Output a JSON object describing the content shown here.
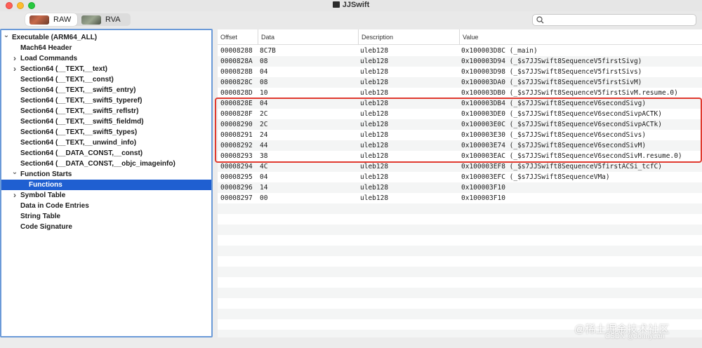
{
  "window": {
    "title": "JJSwift"
  },
  "toolbar": {
    "view_modes": [
      {
        "label": "RAW",
        "active": true
      },
      {
        "label": "RVA",
        "active": false
      }
    ],
    "search": {
      "placeholder": "",
      "value": ""
    }
  },
  "sidebar": {
    "items": [
      {
        "label": "Executable  (ARM64_ALL)",
        "depth": 0,
        "disclosure": "expanded"
      },
      {
        "label": "Mach64 Header",
        "depth": 1,
        "disclosure": "none"
      },
      {
        "label": "Load Commands",
        "depth": 1,
        "disclosure": "collapsed"
      },
      {
        "label": "Section64 (__TEXT,__text)",
        "depth": 1,
        "disclosure": "collapsed"
      },
      {
        "label": "Section64 (__TEXT,__const)",
        "depth": 1,
        "disclosure": "none"
      },
      {
        "label": "Section64 (__TEXT,__swift5_entry)",
        "depth": 1,
        "disclosure": "none"
      },
      {
        "label": "Section64 (__TEXT,__swift5_typeref)",
        "depth": 1,
        "disclosure": "none"
      },
      {
        "label": "Section64 (__TEXT,__swift5_reflstr)",
        "depth": 1,
        "disclosure": "none"
      },
      {
        "label": "Section64 (__TEXT,__swift5_fieldmd)",
        "depth": 1,
        "disclosure": "none"
      },
      {
        "label": "Section64 (__TEXT,__swift5_types)",
        "depth": 1,
        "disclosure": "none"
      },
      {
        "label": "Section64 (__TEXT,__unwind_info)",
        "depth": 1,
        "disclosure": "none"
      },
      {
        "label": "Section64 (__DATA_CONST,__const)",
        "depth": 1,
        "disclosure": "none"
      },
      {
        "label": "Section64 (__DATA_CONST,__objc_imageinfo)",
        "depth": 1,
        "disclosure": "none"
      },
      {
        "label": "Function Starts",
        "depth": 1,
        "disclosure": "expanded"
      },
      {
        "label": "Functions",
        "depth": 2,
        "disclosure": "none",
        "selected": true
      },
      {
        "label": "Symbol Table",
        "depth": 1,
        "disclosure": "collapsed"
      },
      {
        "label": "Data in Code Entries",
        "depth": 1,
        "disclosure": "none"
      },
      {
        "label": "String Table",
        "depth": 1,
        "disclosure": "none"
      },
      {
        "label": "Code Signature",
        "depth": 1,
        "disclosure": "none"
      }
    ]
  },
  "table": {
    "columns": [
      "Offset",
      "Data",
      "Description",
      "Value"
    ],
    "rows": [
      [
        "00008288",
        "8C7B",
        "uleb128",
        "0x100003D8C (_main)"
      ],
      [
        "0000828A",
        "08",
        "uleb128",
        "0x100003D94 (_$s7JJSwift8SequenceV5firstSivg)"
      ],
      [
        "0000828B",
        "04",
        "uleb128",
        "0x100003D98 (_$s7JJSwift8SequenceV5firstSivs)"
      ],
      [
        "0000828C",
        "08",
        "uleb128",
        "0x100003DA0 (_$s7JJSwift8SequenceV5firstSivM)"
      ],
      [
        "0000828D",
        "10",
        "uleb128",
        "0x100003DB0 (_$s7JJSwift8SequenceV5firstSivM.resume.0)"
      ],
      [
        "0000828E",
        "04",
        "uleb128",
        "0x100003DB4 (_$s7JJSwift8SequenceV6secondSivg)"
      ],
      [
        "0000828F",
        "2C",
        "uleb128",
        "0x100003DE0 (_$s7JJSwift8SequenceV6secondSivpACTK)"
      ],
      [
        "00008290",
        "2C",
        "uleb128",
        "0x100003E0C (_$s7JJSwift8SequenceV6secondSivpACTk)"
      ],
      [
        "00008291",
        "24",
        "uleb128",
        "0x100003E30 (_$s7JJSwift8SequenceV6secondSivs)"
      ],
      [
        "00008292",
        "44",
        "uleb128",
        "0x100003E74 (_$s7JJSwift8SequenceV6secondSivM)"
      ],
      [
        "00008293",
        "38",
        "uleb128",
        "0x100003EAC (_$s7JJSwift8SequenceV6secondSivM.resume.0)"
      ],
      [
        "00008294",
        "4C",
        "uleb128",
        "0x100003EF8 (_$s7JJSwift8SequenceV5firstACSi_tcfC)"
      ],
      [
        "00008295",
        "04",
        "uleb128",
        "0x100003EFC (_$s7JJSwift8SequenceVMa)"
      ],
      [
        "00008296",
        "14",
        "uleb128",
        "0x100003F10"
      ],
      [
        "00008297",
        "00",
        "uleb128",
        "0x100003F10"
      ]
    ]
  },
  "watermark": {
    "line1": "@稀土掘金技术社区",
    "line2": "CSDN @JonnyLan"
  },
  "colors": {
    "selection": "#1f5fd1",
    "highlight_border": "#e03a2f",
    "sidebar_border": "#6b9ad8"
  }
}
